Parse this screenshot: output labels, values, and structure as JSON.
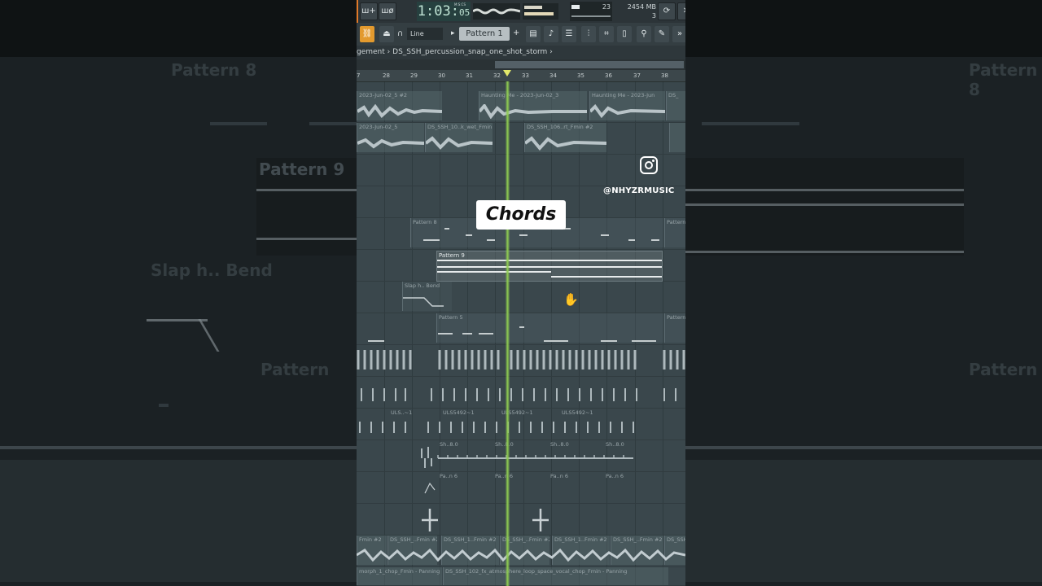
{
  "toolbar": {
    "time_main": "1:03",
    "time_sub": "05",
    "time_label": "M:S:CS",
    "cpu_value": "23",
    "ram_value": "2454 MB",
    "poly_value": "3",
    "snap": "Line",
    "pattern": "Pattern 1"
  },
  "breadcrumb": {
    "prefix": "gement",
    "sep": "›",
    "sample": "DS_SSH_percussion_snap_one_shot_storm",
    "arrow": "›"
  },
  "ruler": {
    "ticks": [
      "7",
      "28",
      "29",
      "30",
      "31",
      "32",
      "33",
      "34",
      "35",
      "36",
      "37",
      "38"
    ]
  },
  "clips": {
    "haunting_a": "2023-Jun-02_5 #2",
    "haunting_b": "Haunting Me - 2023-Jun-02_3",
    "haunting_c": "Haunting Me - 2023-Jun",
    "haunting_d": "DS_",
    "row2_a": "2023-Jun-02_5",
    "row2_b": "DS_SSH_10..k_wet_Fmin",
    "row2_c": "DS_SSH_106..rt_Fmin #2",
    "pattern8": "Pattern 8",
    "pattern8_b": "Pattern",
    "pattern9": "Pattern 9",
    "slap": "Slap h.. Bend",
    "pattern5": "Pattern 5",
    "pattern5_b": "Pattern",
    "uls": "ULS5492~1",
    "uls_short": "ULS..~1",
    "sh": "Sh..8.0",
    "pa": "Pa..n 6",
    "fmin_a": "Fmin #2",
    "fmin_b": "DS_SSH_..Fmin #2",
    "fmin_c": "DS_SSH_1..Fmin #2",
    "last_a": "morph_1_chop_Fmin - Panning",
    "last_b": "DS_SSH_102_fx_atmosphere_loop_space_vocal_chop_Fmin - Panning"
  },
  "overlay": {
    "caption": "Chords",
    "handle": "@NHYZRMUSIC"
  },
  "background_ghosts": {
    "left_1": "Pattern 8",
    "left_2": "Pattern 9",
    "left_3": "Slap h.. Bend",
    "left_4": "Pattern",
    "right_1": "Pattern 8",
    "right_2": "Pattern"
  },
  "colors": {
    "accent_playhead": "#8fcd52",
    "playlist_bg": "#3a474c",
    "caption_bg": "#ffffff"
  }
}
